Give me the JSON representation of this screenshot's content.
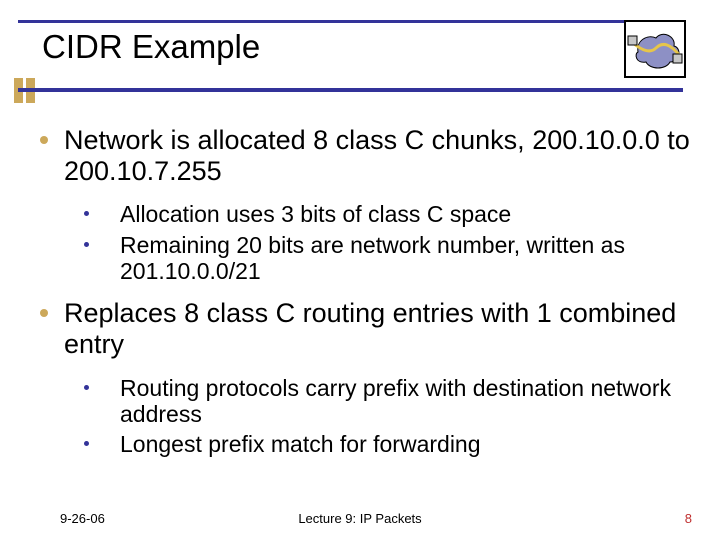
{
  "title": "CIDR Example",
  "bullets": {
    "b1a": "Network is allocated 8 class C chunks, 200.10.0.0 to 200.10.7.255",
    "b2a": "Allocation uses 3 bits of class C space",
    "b2b": "Remaining 20 bits are network number, written as 201.10.0.0/21",
    "b1b": "Replaces 8 class C routing entries with 1 combined entry",
    "b2c": "Routing protocols carry prefix with destination network address",
    "b2d": "Longest prefix match for forwarding"
  },
  "footer": {
    "date": "9-26-06",
    "center": "Lecture 9: IP Packets",
    "page": "8"
  }
}
